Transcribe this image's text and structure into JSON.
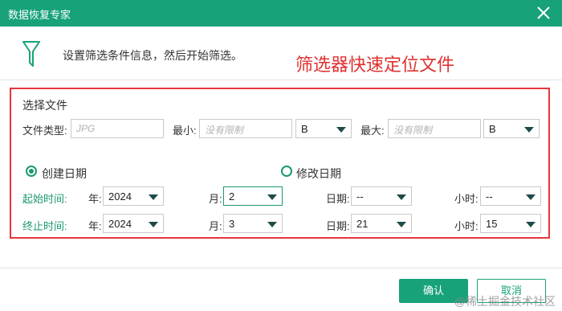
{
  "window": {
    "title": "数据恢复专家",
    "close_icon": "close-icon"
  },
  "header": {
    "icon": "funnel-icon",
    "description": "设置筛选条件信息，然后开始筛选。",
    "annotation": "筛选器快速定位文件",
    "annotation_color": "#e03131"
  },
  "filter": {
    "section_title": "选择文件",
    "file_type": {
      "label": "文件类型:",
      "placeholder": "JPG"
    },
    "min_size": {
      "label": "最小:",
      "placeholder": "没有限制",
      "unit": "B"
    },
    "max_size": {
      "label": "最大:",
      "placeholder": "没有限制",
      "unit": "B"
    }
  },
  "date_mode": {
    "created": {
      "label": "创建日期",
      "checked": true
    },
    "modified": {
      "label": "修改日期",
      "checked": false
    }
  },
  "start_time": {
    "label": "起始时间:",
    "year_label": "年:",
    "year": "2024",
    "month_label": "月:",
    "month": "2",
    "day_label": "日期:",
    "day": "--",
    "hour_label": "小时:",
    "hour": "--"
  },
  "end_time": {
    "label": "终止时间:",
    "year_label": "年:",
    "year": "2024",
    "month_label": "月:",
    "month": "3",
    "day_label": "日期:",
    "day": "21",
    "hour_label": "小时:",
    "hour": "15"
  },
  "buttons": {
    "ok": "确认",
    "cancel": "取消"
  },
  "watermark": "@稀土掘金技术社区",
  "colors": {
    "accent": "#17a27a",
    "highlight": "#e6363c"
  }
}
